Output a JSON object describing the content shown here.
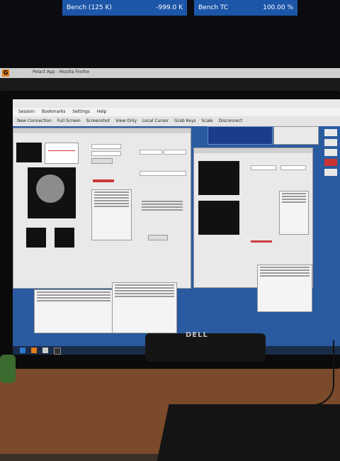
{
  "top_monitor": {
    "panel_left_label": "Bench (125 K)",
    "panel_left_value": "-999.0 K",
    "panel_right_label": "Bench TC",
    "panel_right_value": "100.00 %"
  },
  "firefox": {
    "title": "Pelact App - Mozilla Firefox"
  },
  "remote": {
    "menu": [
      "Session",
      "Bookmarks",
      "Settings",
      "Help"
    ],
    "toolbar": [
      "New Connection",
      "Full Screen",
      "Screenshot",
      "View Only",
      "Local Cursor",
      "Grab Keys",
      "Scale",
      "Disconnect"
    ]
  },
  "monitor_brand": "DELL",
  "colors": {
    "accent_blue": "#1c56a8",
    "desktop_blue": "#2a5aa0"
  }
}
